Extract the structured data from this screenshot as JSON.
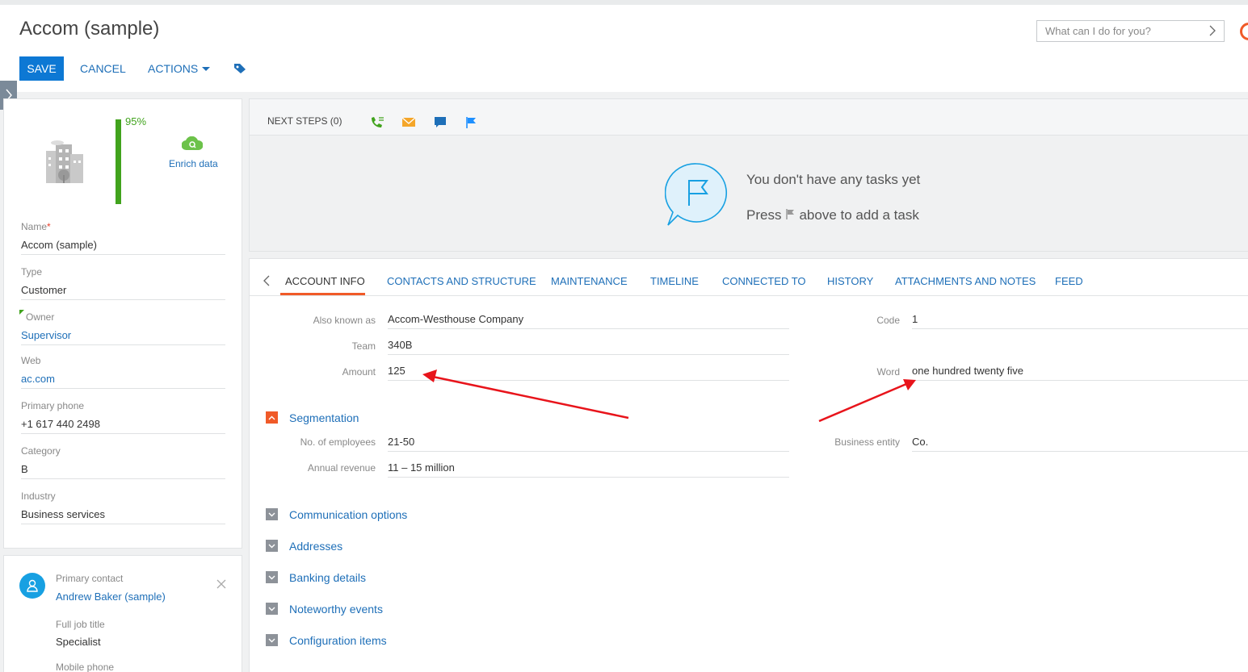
{
  "header": {
    "title": "Accom (sample)",
    "save_label": "SAVE",
    "cancel_label": "CANCEL",
    "actions_label": "ACTIONS",
    "command_placeholder": "What can I do for you?"
  },
  "profile": {
    "completeness": "95%",
    "enrich_label": "Enrich data",
    "fields": {
      "name_label": "Name",
      "name_value": "Accom (sample)",
      "type_label": "Type",
      "type_value": "Customer",
      "owner_label": "Owner",
      "owner_value": "Supervisor",
      "web_label": "Web",
      "web_value": "ac.com",
      "phone_label": "Primary phone",
      "phone_value": "+1 617 440 2498",
      "category_label": "Category",
      "category_value": "B",
      "industry_label": "Industry",
      "industry_value": "Business services"
    }
  },
  "contact": {
    "label": "Primary contact",
    "name": "Andrew Baker (sample)",
    "job_label": "Full job title",
    "job_value": "Specialist",
    "mobile_label": "Mobile phone"
  },
  "next_steps": {
    "tab_label": "NEXT STEPS (0)",
    "empty_line1": "You don't have any tasks yet",
    "empty_press": "Press",
    "empty_after": "above to add a task"
  },
  "tabs": [
    "ACCOUNT INFO",
    "CONTACTS AND STRUCTURE",
    "MAINTENANCE",
    "TIMELINE",
    "CONNECTED TO",
    "HISTORY",
    "ATTACHMENTS AND NOTES",
    "FEED"
  ],
  "account_info": {
    "aka_label": "Also known as",
    "aka_value": "Accom-Westhouse Company",
    "team_label": "Team",
    "team_value": "340B",
    "amount_label": "Amount",
    "amount_value": "125",
    "code_label": "Code",
    "code_value": "1",
    "word_label": "Word",
    "word_value": "one hundred twenty five"
  },
  "segmentation": {
    "title": "Segmentation",
    "employees_label": "No. of employees",
    "employees_value": "21-50",
    "revenue_label": "Annual revenue",
    "revenue_value": "11 – 15 million",
    "entity_label": "Business entity",
    "entity_value": "Co."
  },
  "groups": [
    "Communication options",
    "Addresses",
    "Banking details",
    "Noteworthy events",
    "Configuration items"
  ],
  "colors": {
    "accent": "#0d78d4",
    "link": "#1e6fb8",
    "progress": "#41a31d",
    "active_tab": "#f05a28",
    "annotation_arrow": "#e8141b"
  }
}
